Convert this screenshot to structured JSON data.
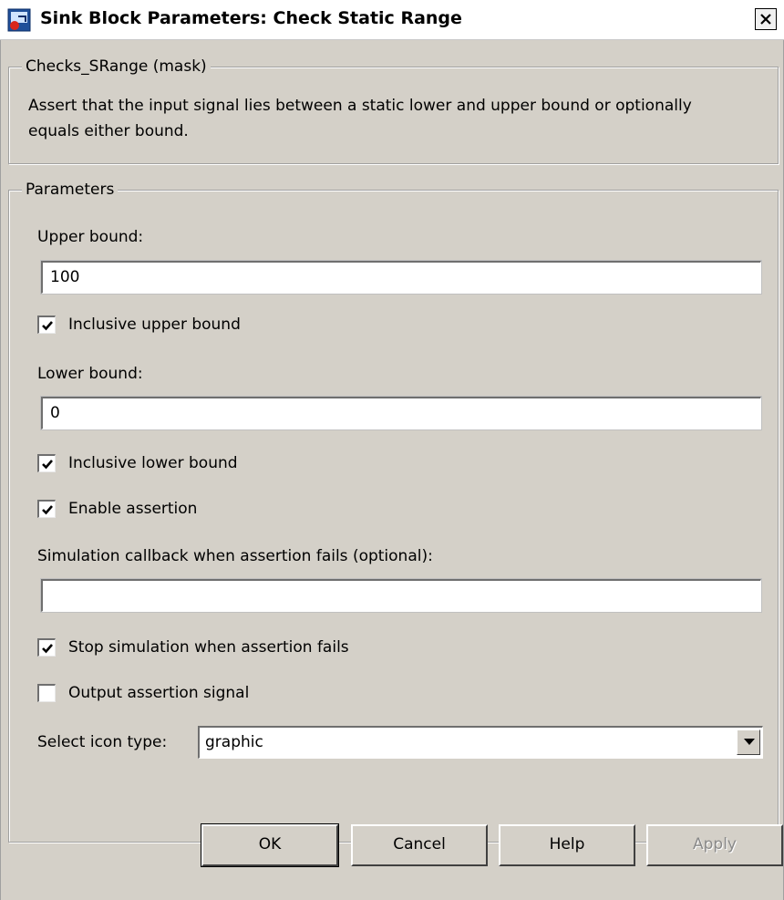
{
  "window": {
    "title": "Sink Block Parameters: Check Static Range",
    "icon": "simulink-block-icon",
    "close_icon": "close-icon"
  },
  "mask_group": {
    "legend": "Checks_SRange (mask)",
    "description": "Assert that the input signal lies between a static lower and upper bound or optionally equals either bound."
  },
  "parameters": {
    "legend": "Parameters",
    "upper_bound_label": "Upper bound:",
    "upper_bound_value": "100",
    "inclusive_upper_label": "Inclusive upper bound",
    "inclusive_upper_checked": true,
    "lower_bound_label": "Lower bound:",
    "lower_bound_value": "0",
    "inclusive_lower_label": "Inclusive lower bound",
    "inclusive_lower_checked": true,
    "enable_assertion_label": "Enable assertion",
    "enable_assertion_checked": true,
    "callback_label": "Simulation callback when assertion fails (optional):",
    "callback_value": "",
    "stop_sim_label": "Stop simulation when assertion fails",
    "stop_sim_checked": true,
    "output_signal_label": "Output assertion signal",
    "output_signal_checked": false,
    "icon_type_label": "Select icon type:",
    "icon_type_value": "graphic"
  },
  "buttons": {
    "ok": "OK",
    "cancel": "Cancel",
    "help": "Help",
    "apply": "Apply"
  },
  "colors": {
    "dialog_background": "#d4d0c8",
    "disabled_text": "#8a8a8a"
  }
}
